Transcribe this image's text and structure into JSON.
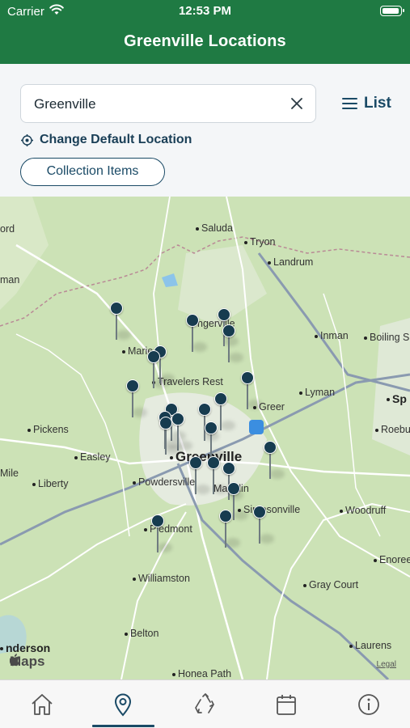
{
  "status_bar": {
    "carrier": "Carrier",
    "time": "12:53 PM"
  },
  "header": {
    "title": "Greenville Locations"
  },
  "search": {
    "value": "Greenville",
    "list_label": "List"
  },
  "actions": {
    "change_location": "Change Default Location",
    "collection_items": "Collection Items"
  },
  "map": {
    "places": [
      "ord",
      "Saluda",
      "Tryon",
      "Landrum",
      "man",
      "Inman",
      "Boiling S",
      "Marie",
      "ngerville",
      "Travelers Rest",
      "Lyman",
      "Greer",
      "Sp",
      "Pickens",
      "Roebu",
      "Easley",
      "Greenville",
      "Mile",
      "Liberty",
      "Powdersville",
      "Mauldin",
      "Simpsonville",
      "Woodruff",
      "Piedmont",
      "Enoree",
      "Williamston",
      "Gray Court",
      "Belton",
      "nderson",
      "Laurens",
      "Honea Path"
    ],
    "attribution": "Maps",
    "legal": "Legal"
  },
  "tabs": [
    "home-icon",
    "location-pin-icon",
    "recycle-icon",
    "calendar-icon",
    "info-icon"
  ],
  "colors": {
    "header": "#1f7a43",
    "accent": "#1a4a66",
    "pin": "#173c4f"
  }
}
